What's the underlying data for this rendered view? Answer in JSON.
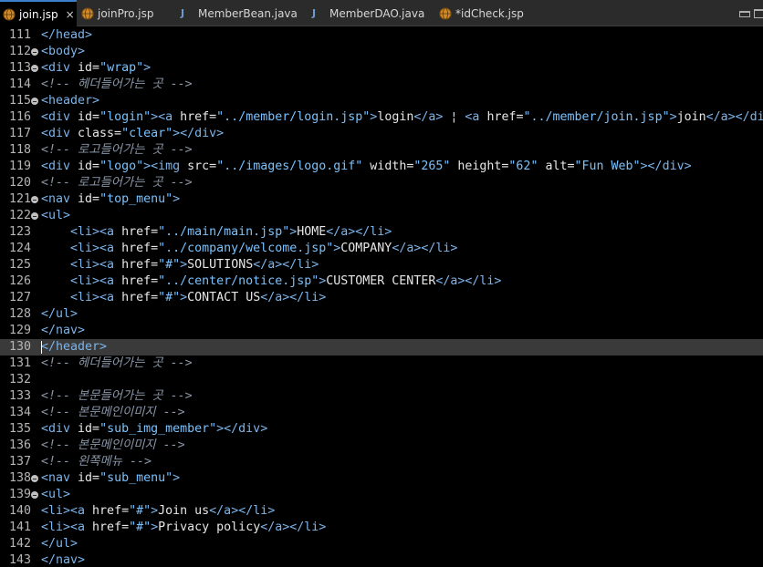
{
  "colors": {
    "tag": "#7db4ea",
    "attr": "#e8e8e8",
    "string": "#79c2ff",
    "comment": "#8a96a8",
    "text": "#e6e6e6",
    "line_number": "#b5b5b5",
    "current_line": "#3a3a3a",
    "tab_active_accent": "#3b7ec9"
  },
  "tabs": [
    {
      "label": "join.jsp",
      "icon": "globe-icon",
      "active": true,
      "close": "×"
    },
    {
      "label": "joinPro.jsp",
      "icon": "globe-icon",
      "active": false
    },
    {
      "label": "MemberBean.java",
      "icon": "java-file-icon",
      "active": false,
      "icon_text": "J"
    },
    {
      "label": "MemberDAO.java",
      "icon": "java-file-icon",
      "active": false,
      "icon_text": "J"
    },
    {
      "label": "*idCheck.jsp",
      "icon": "globe-icon",
      "active": false
    }
  ],
  "editor": {
    "current_line": 130,
    "lines": [
      {
        "n": "111",
        "fold": false,
        "tokens": [
          {
            "c": "tag",
            "t": "</head>"
          }
        ]
      },
      {
        "n": "112",
        "fold": true,
        "tokens": [
          {
            "c": "tag",
            "t": "<body>"
          }
        ]
      },
      {
        "n": "113",
        "fold": true,
        "tokens": [
          {
            "c": "tag",
            "t": "<div "
          },
          {
            "c": "attr",
            "t": "id="
          },
          {
            "c": "str",
            "t": "\"wrap\""
          },
          {
            "c": "tag",
            "t": ">"
          }
        ]
      },
      {
        "n": "114",
        "fold": false,
        "tokens": [
          {
            "c": "cmt",
            "t": "<!-- 헤더들어가는 곳 -->"
          }
        ]
      },
      {
        "n": "115",
        "fold": true,
        "tokens": [
          {
            "c": "tag",
            "t": "<header>"
          }
        ]
      },
      {
        "n": "116",
        "fold": false,
        "tokens": [
          {
            "c": "tag",
            "t": "<div "
          },
          {
            "c": "attr",
            "t": "id="
          },
          {
            "c": "str",
            "t": "\"login\""
          },
          {
            "c": "tag",
            "t": "><a "
          },
          {
            "c": "attr",
            "t": "href="
          },
          {
            "c": "str",
            "t": "\"../member/login.jsp\""
          },
          {
            "c": "tag",
            "t": ">"
          },
          {
            "c": "txt",
            "t": "login"
          },
          {
            "c": "tag",
            "t": "</a>"
          },
          {
            "c": "txt",
            "t": " ¦ "
          },
          {
            "c": "tag",
            "t": "<a "
          },
          {
            "c": "attr",
            "t": "href="
          },
          {
            "c": "str",
            "t": "\"../member/join.jsp\""
          },
          {
            "c": "tag",
            "t": ">"
          },
          {
            "c": "txt",
            "t": "join"
          },
          {
            "c": "tag",
            "t": "</a></di"
          }
        ]
      },
      {
        "n": "117",
        "fold": false,
        "tokens": [
          {
            "c": "tag",
            "t": "<div "
          },
          {
            "c": "attr",
            "t": "class="
          },
          {
            "c": "str",
            "t": "\"clear\""
          },
          {
            "c": "tag",
            "t": "></div>"
          }
        ]
      },
      {
        "n": "118",
        "fold": false,
        "tokens": [
          {
            "c": "cmt",
            "t": "<!-- 로고들어가는 곳 -->"
          }
        ]
      },
      {
        "n": "119",
        "fold": false,
        "tokens": [
          {
            "c": "tag",
            "t": "<div "
          },
          {
            "c": "attr",
            "t": "id="
          },
          {
            "c": "str",
            "t": "\"logo\""
          },
          {
            "c": "tag",
            "t": "><img "
          },
          {
            "c": "attr",
            "t": "src="
          },
          {
            "c": "str",
            "t": "\"../images/logo.gif\""
          },
          {
            "c": "attr",
            "t": " width="
          },
          {
            "c": "str",
            "t": "\"265\""
          },
          {
            "c": "attr",
            "t": " height="
          },
          {
            "c": "str",
            "t": "\"62\""
          },
          {
            "c": "attr",
            "t": " alt="
          },
          {
            "c": "str",
            "t": "\"Fun Web\""
          },
          {
            "c": "tag",
            "t": "></div>"
          }
        ]
      },
      {
        "n": "120",
        "fold": false,
        "tokens": [
          {
            "c": "cmt",
            "t": "<!-- 로고들어가는 곳 -->"
          }
        ]
      },
      {
        "n": "121",
        "fold": true,
        "tokens": [
          {
            "c": "tag",
            "t": "<nav "
          },
          {
            "c": "attr",
            "t": "id="
          },
          {
            "c": "str",
            "t": "\"top_menu\""
          },
          {
            "c": "tag",
            "t": ">"
          }
        ]
      },
      {
        "n": "122",
        "fold": true,
        "tokens": [
          {
            "c": "tag",
            "t": "<ul>"
          }
        ]
      },
      {
        "n": "123",
        "fold": false,
        "tokens": [
          {
            "c": "txt",
            "t": "    "
          },
          {
            "c": "tag",
            "t": "<li><a "
          },
          {
            "c": "attr",
            "t": "href="
          },
          {
            "c": "str",
            "t": "\"../main/main.jsp\""
          },
          {
            "c": "tag",
            "t": ">"
          },
          {
            "c": "txt",
            "t": "HOME"
          },
          {
            "c": "tag",
            "t": "</a></li>"
          }
        ]
      },
      {
        "n": "124",
        "fold": false,
        "tokens": [
          {
            "c": "txt",
            "t": "    "
          },
          {
            "c": "tag",
            "t": "<li><a "
          },
          {
            "c": "attr",
            "t": "href="
          },
          {
            "c": "str",
            "t": "\"../company/welcome.jsp\""
          },
          {
            "c": "tag",
            "t": ">"
          },
          {
            "c": "txt",
            "t": "COMPANY"
          },
          {
            "c": "tag",
            "t": "</a></li>"
          }
        ]
      },
      {
        "n": "125",
        "fold": false,
        "tokens": [
          {
            "c": "txt",
            "t": "    "
          },
          {
            "c": "tag",
            "t": "<li><a "
          },
          {
            "c": "attr",
            "t": "href="
          },
          {
            "c": "str",
            "t": "\"#\""
          },
          {
            "c": "tag",
            "t": ">"
          },
          {
            "c": "txt",
            "t": "SOLUTIONS"
          },
          {
            "c": "tag",
            "t": "</a></li>"
          }
        ]
      },
      {
        "n": "126",
        "fold": false,
        "tokens": [
          {
            "c": "txt",
            "t": "    "
          },
          {
            "c": "tag",
            "t": "<li><a "
          },
          {
            "c": "attr",
            "t": "href="
          },
          {
            "c": "str",
            "t": "\"../center/notice.jsp\""
          },
          {
            "c": "tag",
            "t": ">"
          },
          {
            "c": "txt",
            "t": "CUSTOMER CENTER"
          },
          {
            "c": "tag",
            "t": "</a></li>"
          }
        ]
      },
      {
        "n": "127",
        "fold": false,
        "tokens": [
          {
            "c": "txt",
            "t": "    "
          },
          {
            "c": "tag",
            "t": "<li><a "
          },
          {
            "c": "attr",
            "t": "href="
          },
          {
            "c": "str",
            "t": "\"#\""
          },
          {
            "c": "tag",
            "t": ">"
          },
          {
            "c": "txt",
            "t": "CONTACT US"
          },
          {
            "c": "tag",
            "t": "</a></li>"
          }
        ]
      },
      {
        "n": "128",
        "fold": false,
        "tokens": [
          {
            "c": "tag",
            "t": "</ul>"
          }
        ]
      },
      {
        "n": "129",
        "fold": false,
        "tokens": [
          {
            "c": "tag",
            "t": "</nav>"
          }
        ]
      },
      {
        "n": "130",
        "fold": false,
        "tokens": [
          {
            "c": "tag",
            "t": "</header>"
          }
        ]
      },
      {
        "n": "131",
        "fold": false,
        "tokens": [
          {
            "c": "cmt",
            "t": "<!-- 헤더들어가는 곳 -->"
          }
        ]
      },
      {
        "n": "132",
        "fold": false,
        "tokens": []
      },
      {
        "n": "133",
        "fold": false,
        "tokens": [
          {
            "c": "cmt",
            "t": "<!-- 본문들어가는 곳 -->"
          }
        ]
      },
      {
        "n": "134",
        "fold": false,
        "tokens": [
          {
            "c": "cmt",
            "t": "<!-- 본문메인이미지 -->"
          }
        ]
      },
      {
        "n": "135",
        "fold": false,
        "tokens": [
          {
            "c": "tag",
            "t": "<div "
          },
          {
            "c": "attr",
            "t": "id="
          },
          {
            "c": "str",
            "t": "\"sub_img_member\""
          },
          {
            "c": "tag",
            "t": "></div>"
          }
        ]
      },
      {
        "n": "136",
        "fold": false,
        "tokens": [
          {
            "c": "cmt",
            "t": "<!-- 본문메인이미지 -->"
          }
        ]
      },
      {
        "n": "137",
        "fold": false,
        "tokens": [
          {
            "c": "cmt",
            "t": "<!-- 왼쪽메뉴 -->"
          }
        ]
      },
      {
        "n": "138",
        "fold": true,
        "tokens": [
          {
            "c": "tag",
            "t": "<nav "
          },
          {
            "c": "attr",
            "t": "id="
          },
          {
            "c": "str",
            "t": "\"sub_menu\""
          },
          {
            "c": "tag",
            "t": ">"
          }
        ]
      },
      {
        "n": "139",
        "fold": true,
        "tokens": [
          {
            "c": "tag",
            "t": "<ul>"
          }
        ]
      },
      {
        "n": "140",
        "fold": false,
        "tokens": [
          {
            "c": "tag",
            "t": "<li><a "
          },
          {
            "c": "attr",
            "t": "href="
          },
          {
            "c": "str",
            "t": "\"#\""
          },
          {
            "c": "tag",
            "t": ">"
          },
          {
            "c": "txt",
            "t": "Join us"
          },
          {
            "c": "tag",
            "t": "</a></li>"
          }
        ]
      },
      {
        "n": "141",
        "fold": false,
        "tokens": [
          {
            "c": "tag",
            "t": "<li><a "
          },
          {
            "c": "attr",
            "t": "href="
          },
          {
            "c": "str",
            "t": "\"#\""
          },
          {
            "c": "tag",
            "t": ">"
          },
          {
            "c": "txt",
            "t": "Privacy policy"
          },
          {
            "c": "tag",
            "t": "</a></li>"
          }
        ]
      },
      {
        "n": "142",
        "fold": false,
        "tokens": [
          {
            "c": "tag",
            "t": "</ul>"
          }
        ]
      },
      {
        "n": "143",
        "fold": false,
        "tokens": [
          {
            "c": "tag",
            "t": "</nav>"
          }
        ]
      }
    ]
  }
}
